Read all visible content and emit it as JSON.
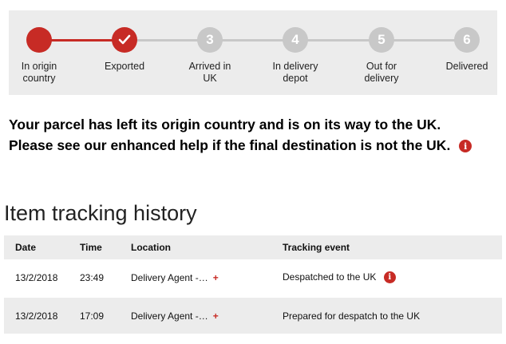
{
  "progress": {
    "steps": [
      {
        "number": "",
        "label": "In origin country",
        "status": "done",
        "icon": "filled-circle"
      },
      {
        "number": "",
        "label": "Exported",
        "status": "current",
        "icon": "check-icon"
      },
      {
        "number": "3",
        "label": "Arrived in UK",
        "status": "todo"
      },
      {
        "number": "4",
        "label": "In delivery depot",
        "status": "todo"
      },
      {
        "number": "5",
        "label": "Out for delivery",
        "status": "todo"
      },
      {
        "number": "6",
        "label": "Delivered",
        "status": "todo"
      }
    ],
    "colors": {
      "done": "#c72b25",
      "todo": "#c8c8c8",
      "panel": "#ececec"
    }
  },
  "message": {
    "line1": "Your parcel has left its origin country and is on its way to the UK.",
    "line2": "Please see our enhanced help if the final destination is not the UK.",
    "info_icon": "i"
  },
  "history": {
    "title": "Item tracking history",
    "columns": [
      "Date",
      "Time",
      "Location",
      "Tracking event"
    ],
    "rows": [
      {
        "date": "13/2/2018",
        "time": "23:49",
        "location": "Delivery Agent -…",
        "more": "+",
        "event": "Despatched to the UK",
        "info": "i"
      },
      {
        "date": "13/2/2018",
        "time": "17:09",
        "location": "Delivery Agent -…",
        "more": "+",
        "event": "Prepared for despatch to the UK",
        "info": ""
      }
    ]
  }
}
